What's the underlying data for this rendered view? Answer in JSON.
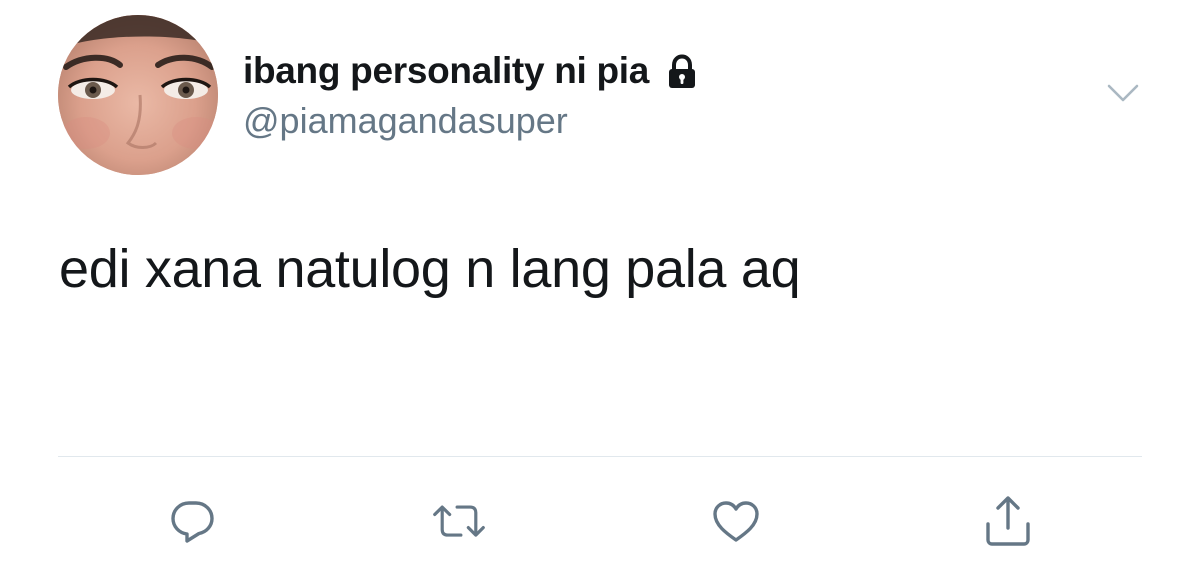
{
  "tweet": {
    "author": {
      "display_name": "ibang personality ni pia",
      "handle": "@piamagandasuper",
      "protected_icon": "lock-icon",
      "avatar_icon": "avatar-photo"
    },
    "text": "edi xana natulog n lang pala aq",
    "menu_icon": "chevron-down-icon",
    "actions": [
      {
        "name": "reply",
        "icon": "reply-icon"
      },
      {
        "name": "retweet",
        "icon": "retweet-icon"
      },
      {
        "name": "like",
        "icon": "heart-icon"
      },
      {
        "name": "share",
        "icon": "share-icon"
      }
    ]
  },
  "colors": {
    "text_primary": "#14171a",
    "text_secondary": "#657786",
    "icon_gray": "#657786",
    "divider": "#e1e8ed",
    "background": "#ffffff"
  }
}
